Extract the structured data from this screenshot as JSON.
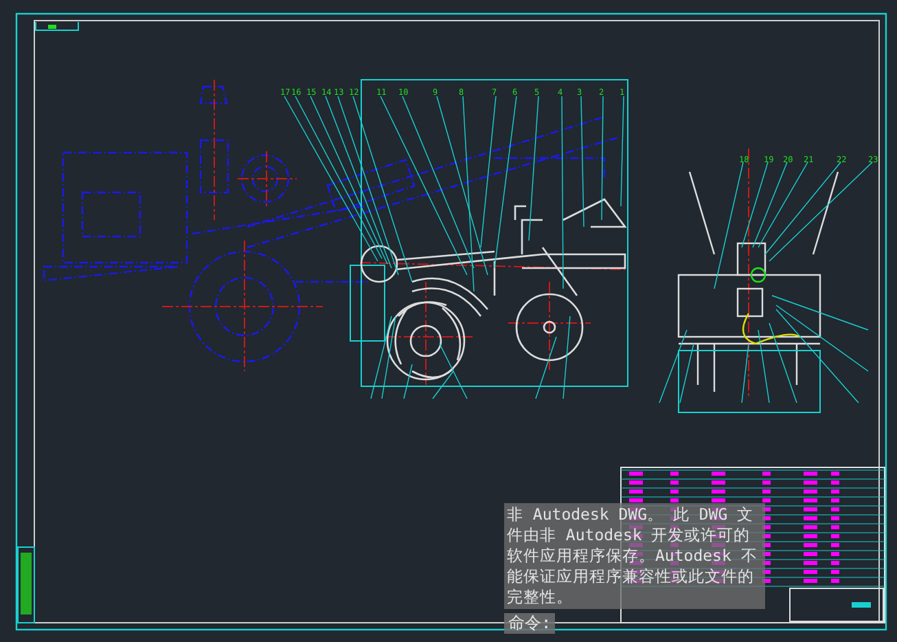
{
  "front_view_balloons": [
    "17",
    "16",
    "15",
    "14",
    "13",
    "12",
    "11",
    "10",
    "9",
    "8",
    "7",
    "6",
    "5",
    "4",
    "3",
    "2",
    "1"
  ],
  "side_view_balloons": [
    "18",
    "19",
    "20",
    "21",
    "22",
    "23"
  ],
  "message": {
    "text": "非 Autodesk DWG。 此 DWG 文件由非 Autodesk 开发或许可的软件应用程序保存。Autodesk 不能保证应用程序兼容性或此文件的完整性。"
  },
  "command_prompt": "命令:"
}
